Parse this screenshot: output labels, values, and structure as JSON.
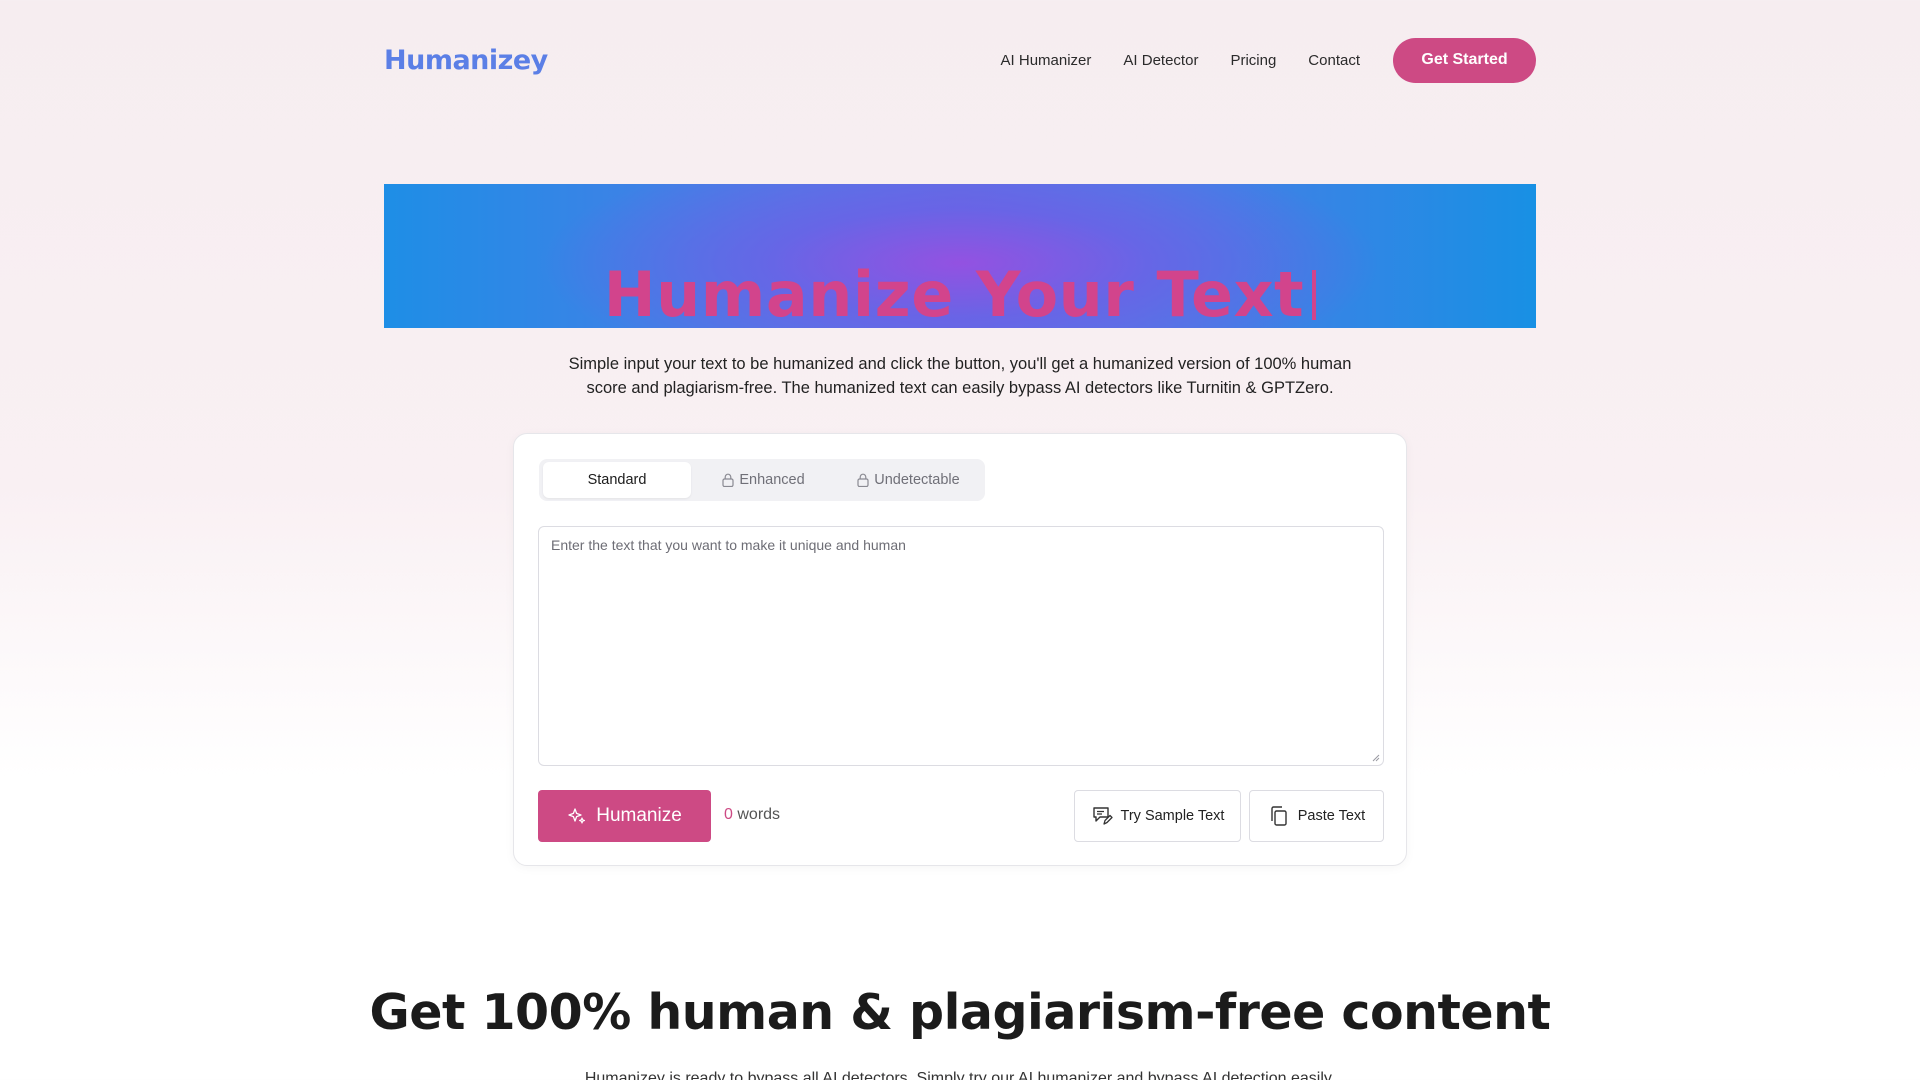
{
  "header": {
    "logo": "Humanizey",
    "nav": [
      {
        "label": "AI Humanizer"
      },
      {
        "label": "AI Detector"
      },
      {
        "label": "Pricing"
      },
      {
        "label": "Contact"
      }
    ],
    "cta_label": "Get Started"
  },
  "hero": {
    "title": "Humanize Your Text",
    "subtitle_line1": "Simple input your text to be humanized and click the button, you'll get a humanized version of 100% human",
    "subtitle_line2": "score and plagiarism-free. The humanized text can easily bypass AI detectors like Turnitin & GPTZero."
  },
  "tool": {
    "tabs": [
      {
        "label": "Standard",
        "active": true,
        "locked": false
      },
      {
        "label": "Enhanced",
        "active": false,
        "locked": true
      },
      {
        "label": "Undetectable",
        "active": false,
        "locked": true
      }
    ],
    "textarea_placeholder": "Enter the text that you want to make it unique and human",
    "textarea_value": "",
    "humanize_label": "Humanize",
    "word_count": "0",
    "word_unit": "words",
    "sample_label": "Try Sample Text",
    "paste_label": "Paste Text"
  },
  "section": {
    "title": "Get 100% human & plagiarism-free content",
    "subtitle": "Humanizey is ready to bypass all AI detectors. Simply try our AI humanizer and bypass AI detection easily."
  },
  "colors": {
    "brand_blue": "#5b7fe6",
    "accent_pink": "#cd4a84",
    "banner_blue": "#1e8ee6",
    "banner_purple": "#9650e1"
  },
  "icons": {
    "lock": "lock-icon",
    "sparkle": "sparkle-icon",
    "sample": "chat-edit-icon",
    "paste": "copy-icon"
  }
}
